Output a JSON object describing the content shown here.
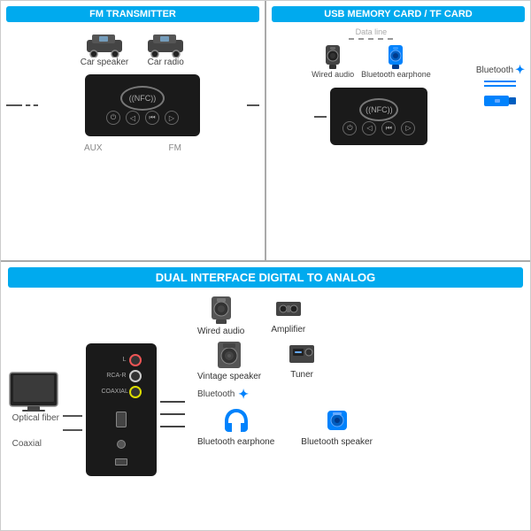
{
  "panels": {
    "fm": {
      "title": "FM TRANSMITTER",
      "items": [
        "Car speaker",
        "Car radio"
      ],
      "labels": [
        "AUX",
        "FM"
      ],
      "nfc_text": "((NFC))"
    },
    "usb": {
      "title": "USB MEMORY CARD / TF CARD",
      "data_line": "Data line",
      "items": [
        "Wired audio",
        "Bluetooth earphone"
      ],
      "bluetooth_label": "Bluetooth",
      "nfc_text": "((NFC))"
    },
    "dual": {
      "title": "DUAL INTERFACE DIGITAL TO ANALOG",
      "left_labels": [
        "Optical fiber",
        "Coaxial"
      ],
      "bluetooth_label": "Bluetooth",
      "outputs": [
        {
          "label": "Wired audio"
        },
        {
          "label": "Amplifier"
        },
        {
          "label": "Vintage speaker"
        },
        {
          "label": "Tuner"
        },
        {
          "label": "Bluetooth earphone"
        },
        {
          "label": "Bluetooth speaker"
        }
      ]
    }
  }
}
